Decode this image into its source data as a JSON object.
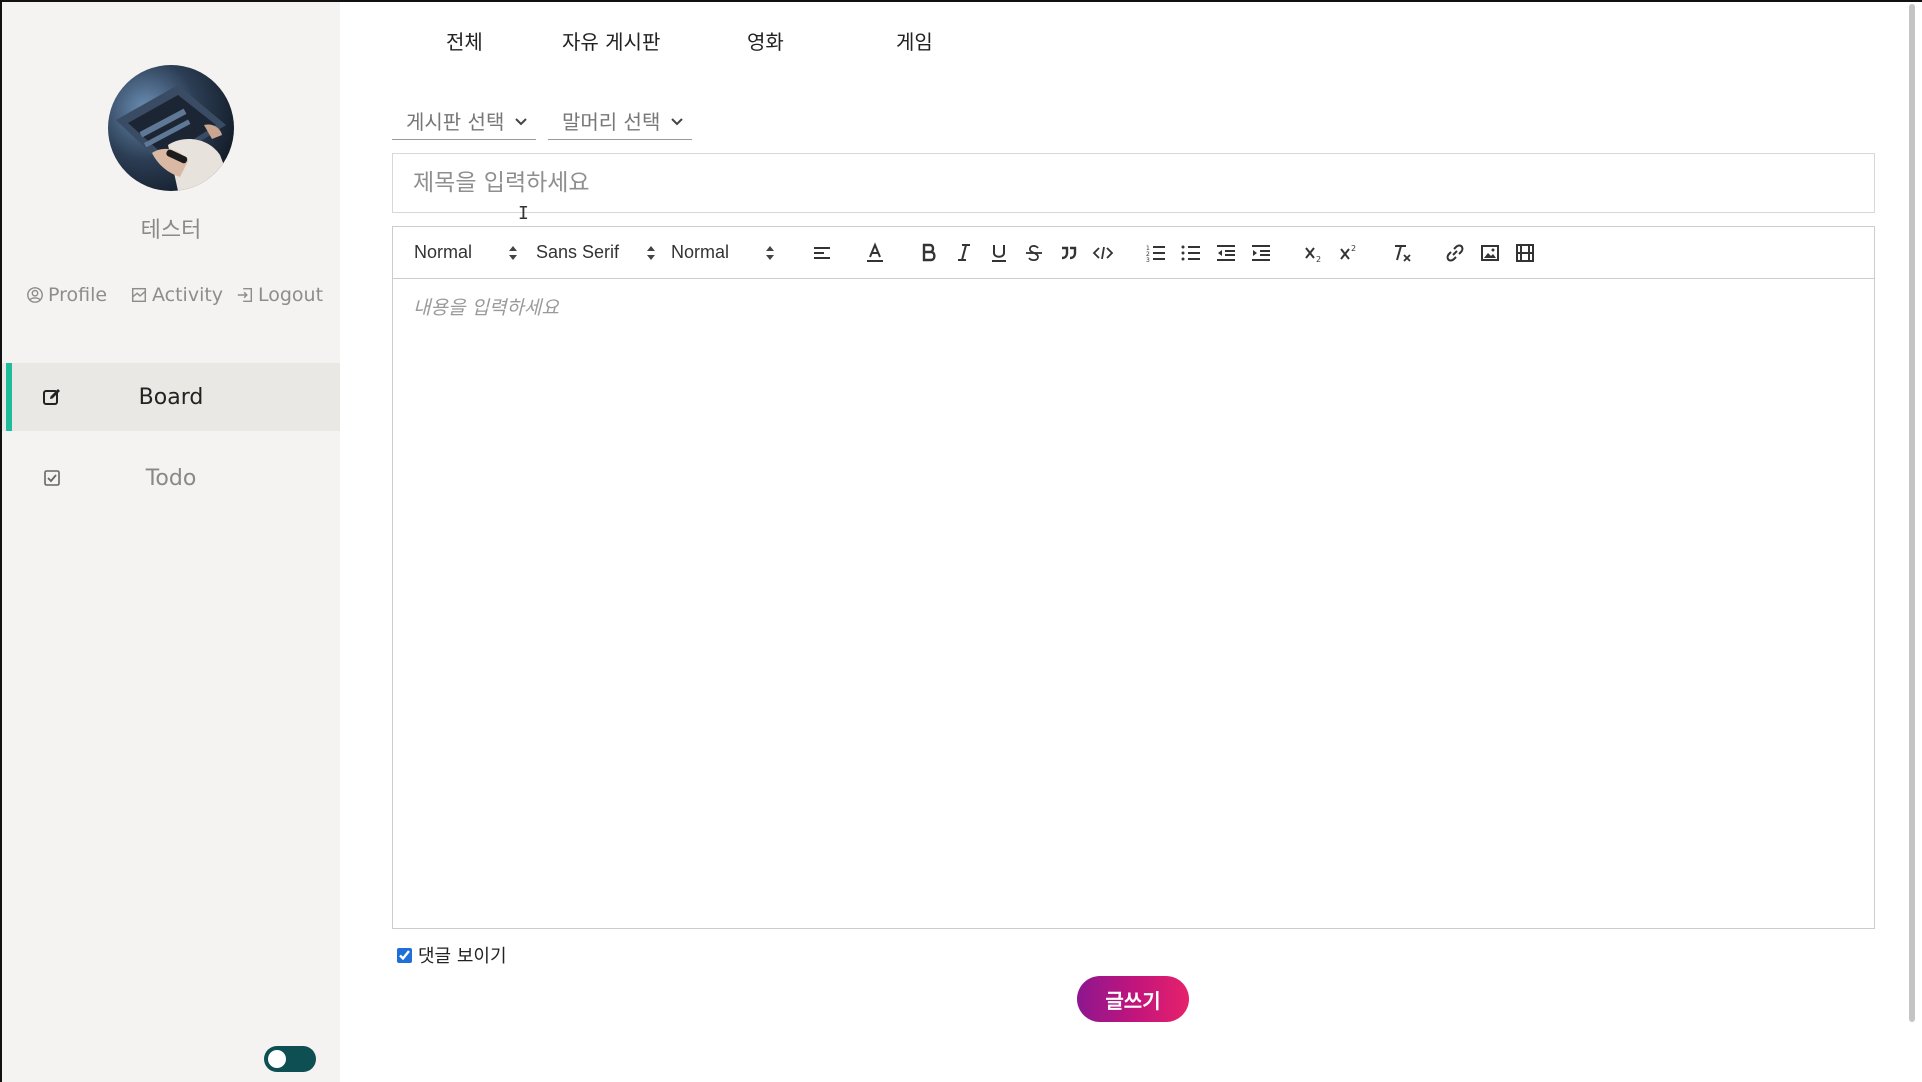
{
  "sidebar": {
    "user_name": "테스터",
    "links": {
      "profile": "Profile",
      "activity": "Activity",
      "logout": "Logout"
    },
    "nav": [
      {
        "label": "Board",
        "active": true,
        "icon": "edit-icon"
      },
      {
        "label": "Todo",
        "active": false,
        "icon": "checkbox-icon"
      }
    ],
    "theme_toggle": "dark-mode-toggle"
  },
  "tabs": [
    "전체",
    "자유 게시판",
    "영화",
    "게임"
  ],
  "selects": {
    "board": "게시판 선택",
    "prefix": "말머리 선택"
  },
  "title_input": {
    "placeholder": "제목을 입력하세요",
    "value": ""
  },
  "toolbar": {
    "header": "Normal",
    "font": "Sans Serif",
    "size": "Normal",
    "buttons": [
      "align-icon",
      "text-color-icon",
      "bold-icon",
      "italic-icon",
      "underline-icon",
      "strike-icon",
      "blockquote-icon",
      "code-icon",
      "ordered-list-icon",
      "bullet-list-icon",
      "outdent-icon",
      "indent-icon",
      "subscript-icon",
      "superscript-icon",
      "clear-format-icon",
      "link-icon",
      "image-icon",
      "video-icon"
    ]
  },
  "editor": {
    "placeholder": "내용을 입력하세요"
  },
  "comment_toggle": {
    "label": "댓글 보이기",
    "checked": true
  },
  "submit_label": "글쓰기",
  "colors": {
    "accent": "#1fbc9c",
    "toggle": "#0d4f52",
    "button_start": "#8d168f",
    "button_end": "#e6226b"
  }
}
